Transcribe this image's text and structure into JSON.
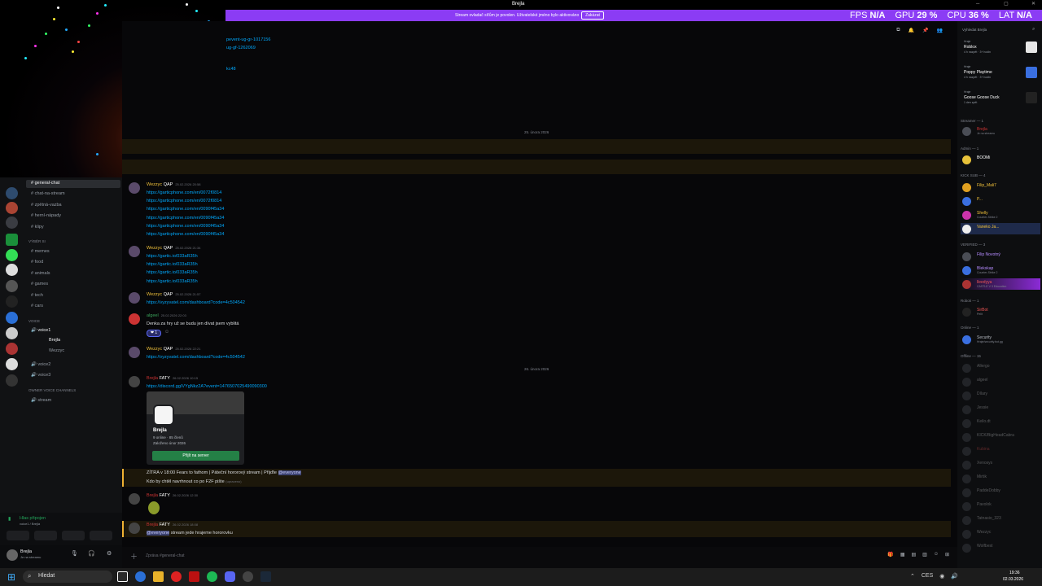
{
  "window": {
    "title": "Brejla"
  },
  "banner": {
    "message": "Stream ovladač síťům je povolen. Uživatelské jméno bylo aktivováno",
    "button": "Zakázat"
  },
  "perf": {
    "fps_label": "FPS",
    "fps": "N/A",
    "gpu_label": "GPU",
    "gpu": "29 %",
    "cpu_label": "CPU",
    "cpu": "36 %",
    "lat_label": "LAT",
    "lat": "N/A"
  },
  "channels": {
    "general": "general-chat",
    "items_top": [
      "chat-na-stream",
      "zpětná-vazba",
      "herní-nápady",
      "klipy"
    ],
    "cat_tvurci": "VÝBĚR SI",
    "items_mid": [
      "memes",
      "food",
      "animals",
      "games",
      "tech",
      "cars"
    ],
    "cat_voice": "VOICE",
    "voice1": "voice1",
    "voice_users": [
      "Brejla",
      "Wezzyc"
    ],
    "voice2": "voice2",
    "voice3": "voice3",
    "cat_owner": "OWNER VOICE CHANNELS",
    "stream": "stream",
    "voice_status": "Hlas připojen",
    "voice_sub": "voice1 / Brejla",
    "user_name": "Brejla",
    "user_status": "Je na streamu"
  },
  "chat": {
    "top_links": [
      "pevent-ug-gr-1017156",
      "ug-gf-1262069",
      "kc48"
    ],
    "date1": "25. února 2026",
    "msg1": {
      "user": "Wezzyc",
      "tag": "QAP",
      "time": "25.02.2026 20:58",
      "links": [
        "https://garticphone.com/en/0072f0814",
        "https://garticphone.com/en/0072f0814",
        "https://garticphone.com/en/0090f45a34",
        "https://garticphone.com/en/0090f45a34",
        "https://garticphone.com/en/0090f45a34",
        "https://garticphone.com/en/0090f45a34"
      ]
    },
    "msg2": {
      "user": "Wezzyc",
      "tag": "QAP",
      "time": "25.02.2026 21:34",
      "links": [
        "https://gartic.io/033aR35h",
        "https://gartic.io/033aR35h",
        "https://gartic.io/033aR35h",
        "https://gartic.io/033aR35h"
      ]
    },
    "msg3": {
      "user": "Wezzyc",
      "tag": "QAP",
      "time": "25.02.2026 21:57",
      "link": "https://vyzyvatel.com/dashboard?code=4c504542"
    },
    "msg4": {
      "user": "algeel",
      "time": "25.02.2026 22:03",
      "text": "Denka za hry už se budu jen dívat jsem vyblitá",
      "reaction": "1"
    },
    "msg5": {
      "user": "Wezzyc",
      "tag": "QAP",
      "time": "25.02.2026 22:21",
      "link": "https://vyzyvatel.com/dashboard?code=4c504542"
    },
    "date2": "26. února 2026",
    "msg6": {
      "user": "Brejla",
      "tag": "FATY",
      "time": "26.02.2026 10:15",
      "link": "https://discord.gg/VYgNkz2A?event=1476507025490090300",
      "invite_name": "Brejla",
      "invite_stats": "9 online · 85 členů",
      "invite_since": "Založeno únor 2026",
      "invite_btn": "Přijít na server"
    },
    "msg7": {
      "text": "ZÍTRA v 18:00 Fears to fathom | Páteční hororový stream | Přijďte",
      "mention": "@everyone",
      "text2": "Kdo by chtěl navrhnout co po F2F pište",
      "edited": "(upraveno)"
    },
    "msg8": {
      "user": "Brejla",
      "tag": "FATY",
      "time": "26.02.2026 12:30"
    },
    "msg9": {
      "user": "Brejla",
      "tag": "FATY",
      "time": "26.02.2026 18:08",
      "mention": "@everyone",
      "text": "stream jede hrajeme hororovku"
    },
    "input_placeholder": "Zpráva #general-chat"
  },
  "members": {
    "activity_header": "Vyhledat Brejla",
    "activities": [
      {
        "label": "Hraje",
        "game": "Roblox",
        "sub": "4 h nazpět · 3+ hodin"
      },
      {
        "label": "Hraje",
        "game": "Poppy Playtime",
        "sub": "4 h nazpět · 3+ hodin"
      },
      {
        "label": "Hraje",
        "game": "Goose Goose Duck",
        "sub": "1 den zpět"
      }
    ],
    "cat_streamer": "Streamer — 1",
    "streamer": [
      {
        "name": "Brejla",
        "sub": "Je na streamu"
      }
    ],
    "cat_admin": "Admin — 1",
    "admin": [
      {
        "name": "BOOMi",
        "sub": ""
      }
    ],
    "cat_kick": "KICK SUB — 4",
    "kick": [
      {
        "name": "Filip_Mali7",
        "sub": ""
      },
      {
        "name": "P...",
        "sub": ""
      },
      {
        "name": "Shelly",
        "sub": "Counter-Strike 2"
      },
      {
        "name": "Vaneko Ja...",
        "sub": ""
      }
    ],
    "cat_verified": "VERIFIED — 3",
    "verified": [
      {
        "name": "Filip Novotný",
        "sub": ""
      },
      {
        "name": "Blekskap",
        "sub": "Counter-Strike 2"
      },
      {
        "name": "lleedyya",
        "sub": "CASTLE V 3 Education"
      }
    ],
    "cat_roboti": "Roboti — 1",
    "roboti": [
      {
        "name": "SirBot",
        "sub": "Pelit"
      }
    ],
    "cat_online": "Online — 1",
    "online": [
      {
        "name": "Security",
        "sub": "Hraje/security.bot.gg"
      }
    ],
    "cat_offline": "Offline — 15",
    "offline": [
      "Allergo",
      "algeel",
      "Dílary",
      "Jessie",
      "Keilo.dt",
      "KICK/BigHeadCabra",
      "Kubina",
      "Xenosys",
      "Mirtik",
      "PaddeDobby",
      "Pavolok",
      "Tatnasio_323",
      "Wezzyc",
      "Wolfbest"
    ]
  },
  "taskbar": {
    "search": "Hledat",
    "lang": "CES",
    "time": "19:36",
    "date": "02.03.2026"
  }
}
